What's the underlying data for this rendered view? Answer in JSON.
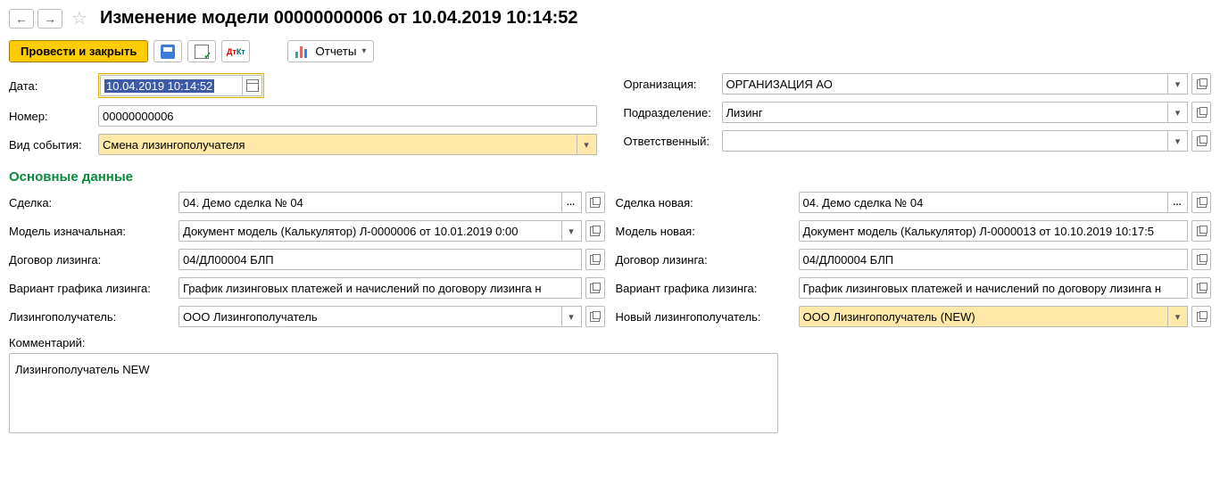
{
  "nav": {
    "back": "←",
    "forward": "→"
  },
  "title": "Изменение модели 00000000006 от 10.04.2019 10:14:52",
  "toolbar": {
    "primary": "Провести и закрыть",
    "reports": "Отчеты"
  },
  "form_left": {
    "date_label": "Дата:",
    "date_value": "10.04.2019 10:14:52",
    "number_label": "Номер:",
    "number_value": "00000000006",
    "event_label": "Вид события:",
    "event_value": "Смена лизингополучателя"
  },
  "form_right": {
    "org_label": "Организация:",
    "org_value": "ОРГАНИЗАЦИЯ АО",
    "dept_label": "Подразделение:",
    "dept_value": "Лизинг",
    "resp_label": "Ответственный:",
    "resp_value": ""
  },
  "section_title": "Основные данные",
  "main_left": {
    "deal_label": "Сделка:",
    "deal_value": "04. Демо сделка № 04",
    "model_label": "Модель изначальная:",
    "model_value": "Документ модель (Калькулятор) Л-0000006 от 10.01.2019 0:00",
    "contract_label": "Договор лизинга:",
    "contract_value": "04/ДЛ00004 БЛП",
    "schedule_label": "Вариант графика лизинга:",
    "schedule_value": "График лизинговых платежей и начислений по договору лизинга н",
    "lessee_label": "Лизингополучатель:",
    "lessee_value": "ООО Лизингополучатель"
  },
  "main_right": {
    "deal_label": "Сделка новая:",
    "deal_value": "04. Демо сделка № 04",
    "model_label": "Модель новая:",
    "model_value": "Документ модель (Калькулятор) Л-0000013 от 10.10.2019 10:17:5",
    "contract_label": "Договор лизинга:",
    "contract_value": "04/ДЛ00004 БЛП",
    "schedule_label": "Вариант графика лизинга:",
    "schedule_value": "График лизинговых платежей и начислений по договору лизинга н",
    "lessee_label": "Новый лизингополучатель:",
    "lessee_value": "ООО Лизингополучатель (NEW)"
  },
  "comment": {
    "label": "Комментарий:",
    "value": "Лизингополучатель NEW"
  }
}
